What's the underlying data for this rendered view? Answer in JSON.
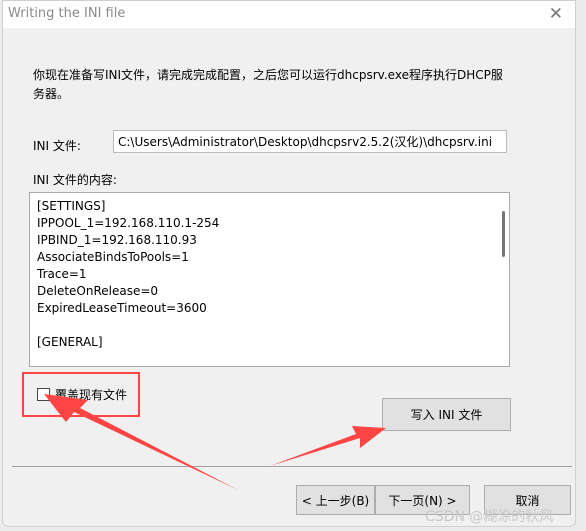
{
  "window": {
    "title": "Writing the INI file",
    "close_icon": "close-icon"
  },
  "intro": "你现在准备写INI文件，请完成完成配置，之后您可以运行dhcpsrv.exe程序执行DHCP服务器。",
  "ini_file": {
    "label": "INI 文件:",
    "value": "C:\\Users\\Administrator\\Desktop\\dhcpsrv2.5.2(汉化)\\dhcpsrv.ini"
  },
  "content": {
    "label": "INI 文件的内容:",
    "lines": "[SETTINGS]\nIPPOOL_1=192.168.110.1-254\nIPBIND_1=192.168.110.93\nAssociateBindsToPools=1\nTrace=1\nDeleteOnRelease=0\nExpiredLeaseTimeout=3600\n\n[GENERAL]"
  },
  "overwrite": {
    "label": "覆盖现有文件",
    "checked": false
  },
  "buttons": {
    "write": "写入 INI 文件",
    "back": "< 上一步(B)",
    "next": "下一页(N) >",
    "cancel": "取消"
  },
  "watermark": "CSDN @糊涂的秋风",
  "colors": {
    "annotation": "#f44444"
  }
}
